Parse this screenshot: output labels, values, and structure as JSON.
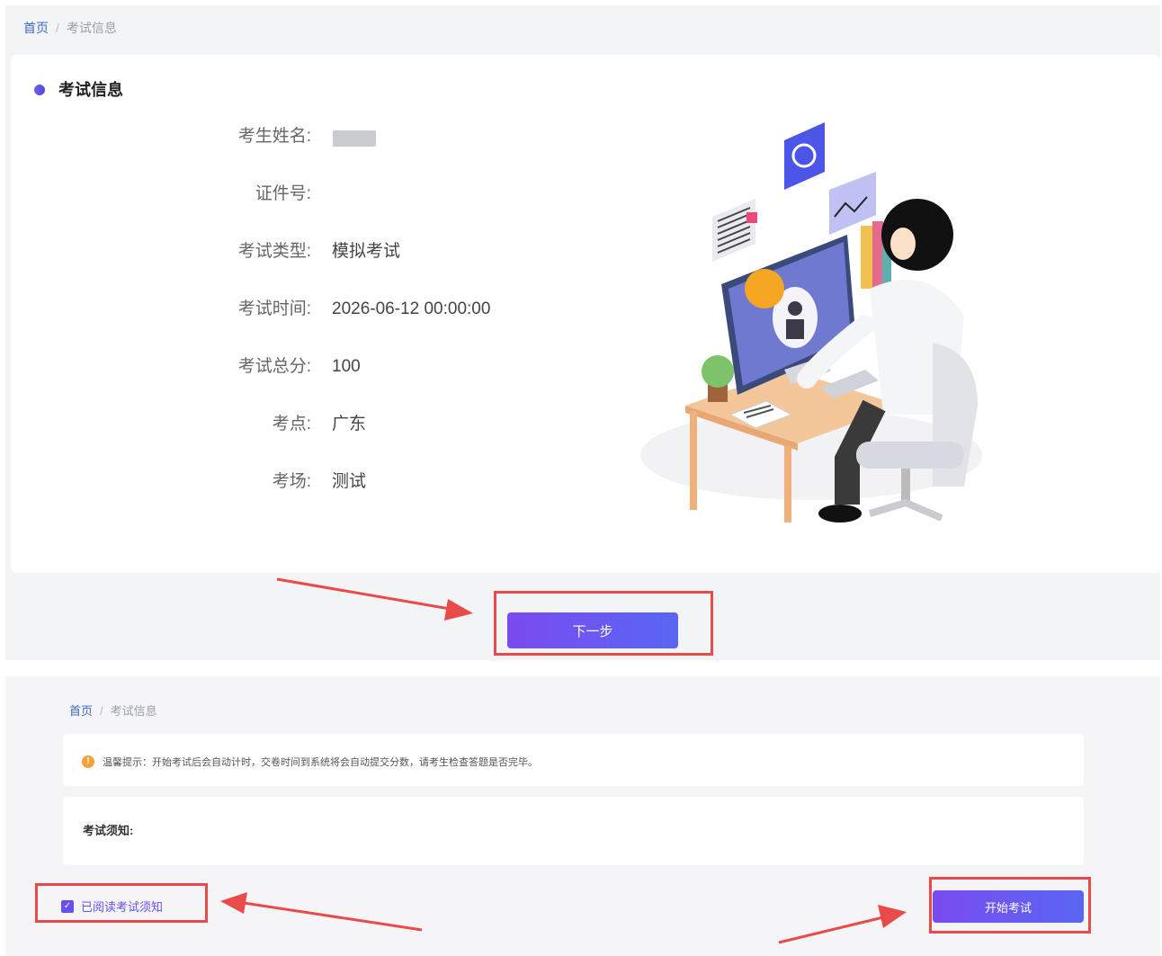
{
  "panel1": {
    "breadcrumb": {
      "home": "首页",
      "separator": "/",
      "current": "考试信息"
    },
    "section_title": "考试信息",
    "fields": [
      {
        "label": "考生姓名:",
        "value": ""
      },
      {
        "label": "证件号:",
        "value": ""
      },
      {
        "label": "考试类型:",
        "value": "模拟考试"
      },
      {
        "label": "考试时间:",
        "value": "2026-06-12 00:00:00"
      },
      {
        "label": "考试总分:",
        "value": "100"
      },
      {
        "label": "考点:",
        "value": "广东"
      },
      {
        "label": "考场:",
        "value": "测试"
      }
    ],
    "next_button": "下一步"
  },
  "panel2": {
    "breadcrumb": {
      "home": "首页",
      "separator": "/",
      "current": "考试信息"
    },
    "notice": "温馨提示：开始考试后会自动计时，交卷时间到系统将会自动提交分数，请考生检查答题是否完毕。",
    "rules_title": "考试须知:",
    "agree_label": "已阅读考试须知",
    "agree_checked": true,
    "start_button": "开始考试"
  },
  "colors": {
    "accent": "#6a4ef0",
    "highlight": "#e94a4a",
    "link": "#3a68c8",
    "warning": "#f5a03c"
  }
}
